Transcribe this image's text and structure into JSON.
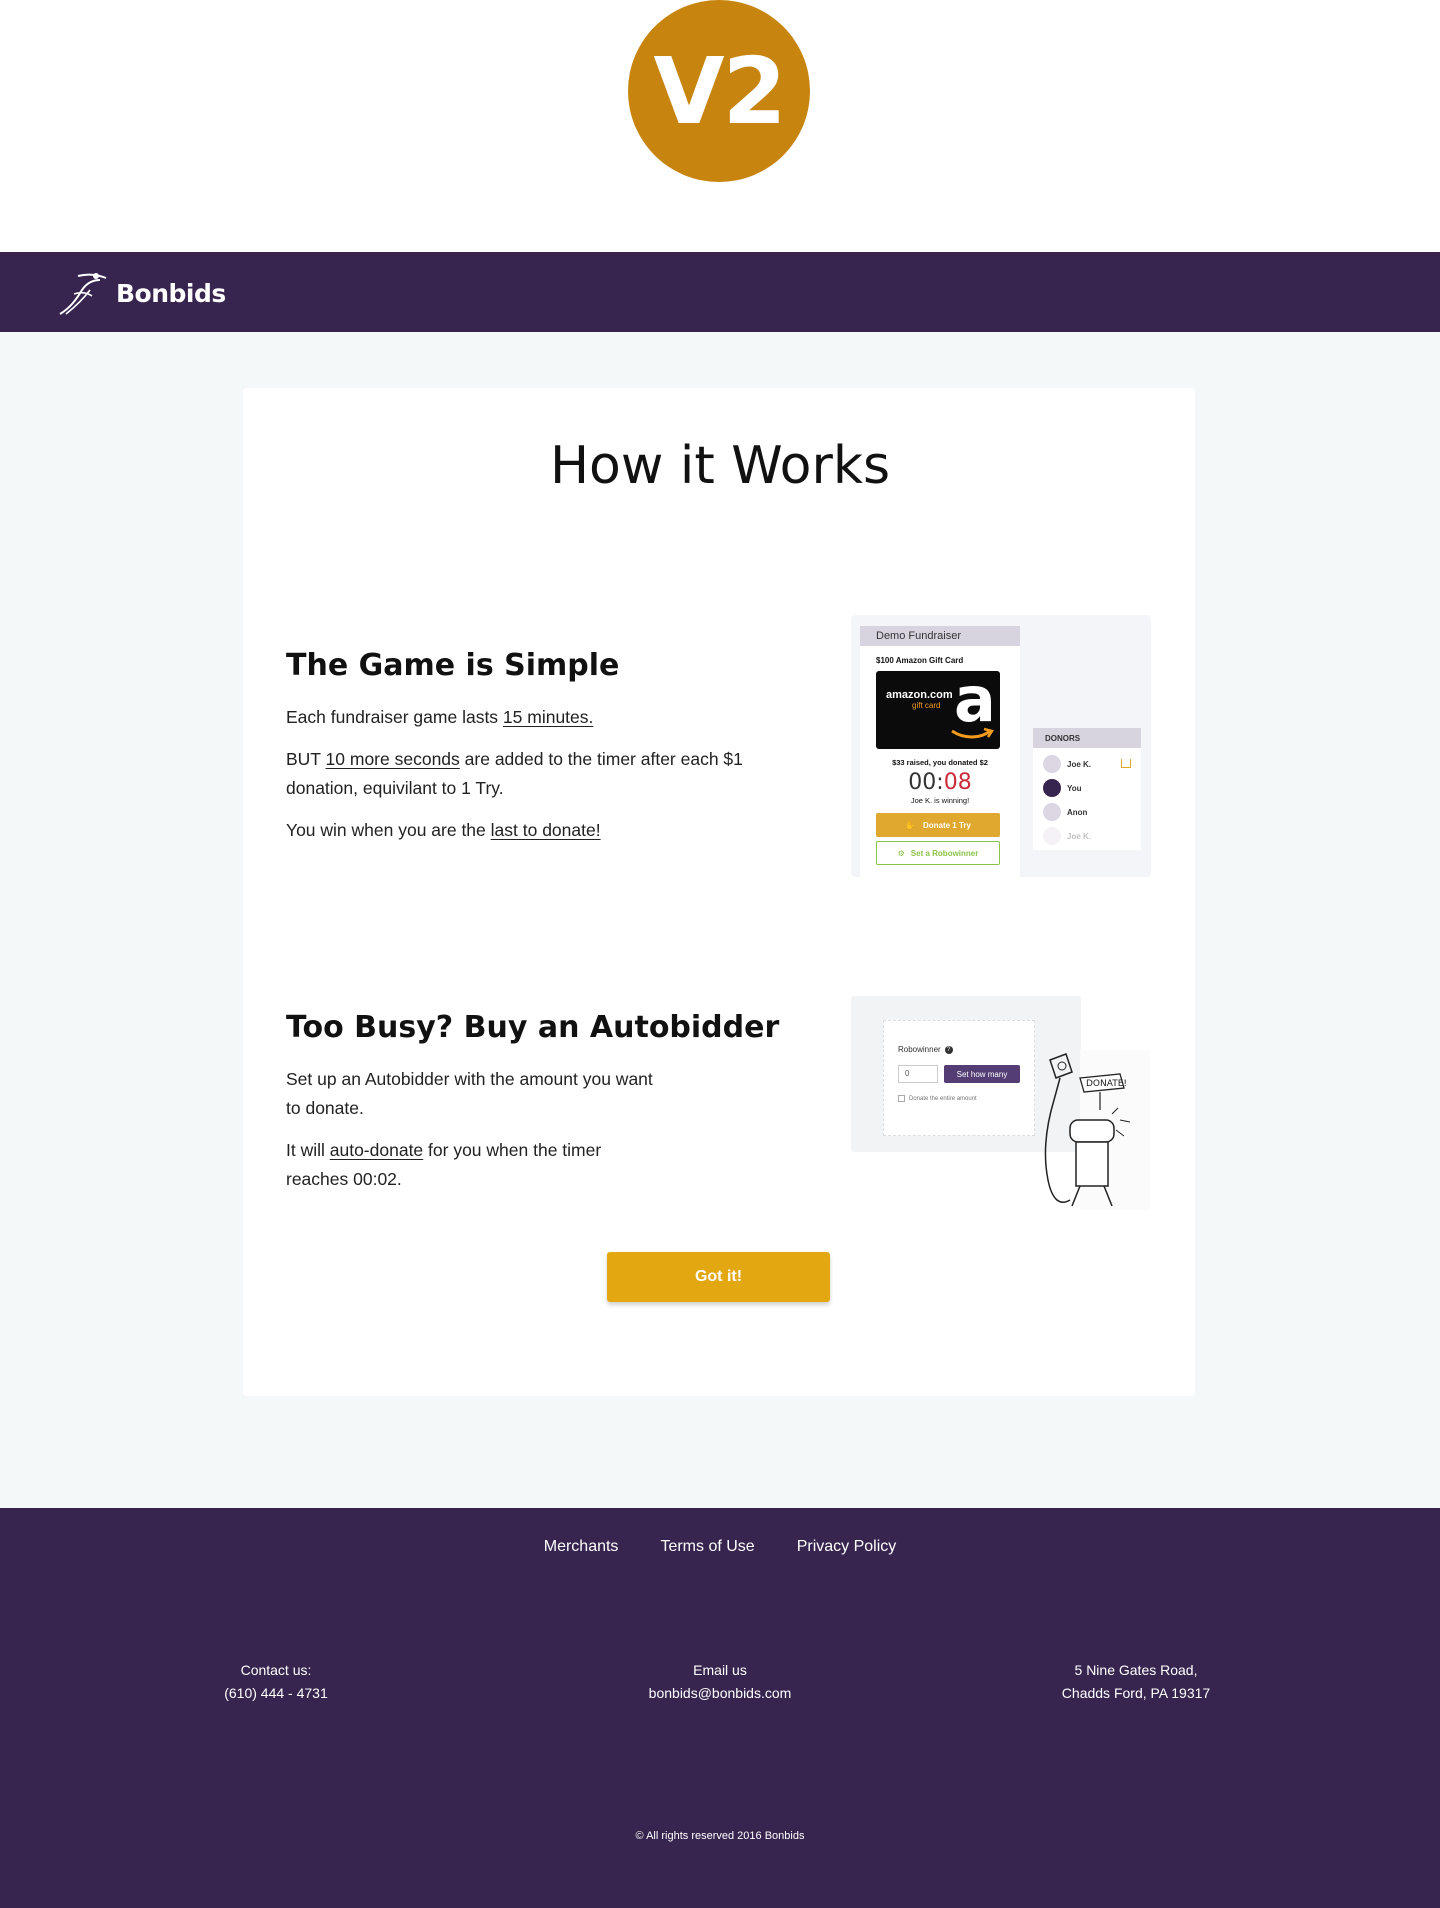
{
  "badge": {
    "label": "V2"
  },
  "header": {
    "brand": "Bonbids"
  },
  "main": {
    "title": "How it Works",
    "section1": {
      "title": "The Game is Simple",
      "p1_pre": "Each fundraiser game lasts ",
      "p1_link": "15 minutes. ",
      "p2_pre": "BUT ",
      "p2_link": "10 more seconds",
      "p2_post": " are added to the timer after each $1",
      "p2_line2": "donation, equivilant to 1 Try.",
      "p3_pre": "You win when you are the ",
      "p3_link": "last to donate!"
    },
    "section2": {
      "title": "Too Busy? Buy an Autobidder",
      "p1_line1": "Set up an Autobidder with the amount you want",
      "p1_line2": "to donate.",
      "p2_pre": "It will ",
      "p2_link": "auto-donate",
      "p2_post": " for you when the timer",
      "p2_line2": "reaches 00:02."
    },
    "cta": "Got it!"
  },
  "demo": {
    "header": "Demo Fundraiser",
    "prize": "$100 Amazon Gift Card",
    "gift_text": "amazon.com",
    "gift_sub": "gift card",
    "gift_letter": "a",
    "raised": "$33 raised, you donated $2",
    "timer_min": "00:",
    "timer_sec": "08",
    "winning": "Joe K. is winning!",
    "donate_btn": "Donate 1 Try",
    "robo_btn": "Set a Robowinner",
    "donors_title": "DONORS",
    "donors": [
      "Joe K.",
      "You",
      "Anon",
      "Joe K."
    ]
  },
  "robo": {
    "label": "Robowinner",
    "qmark": "?",
    "input_value": "0",
    "button": "Set how many",
    "check": "Donate the entire amount",
    "sign": "DONATE!"
  },
  "footer": {
    "links": [
      "Merchants",
      "Terms of Use",
      "Privacy Policy"
    ],
    "contact_label": "Contact us:",
    "contact_phone": "(610) 444 - 4731",
    "email_label": "Email us",
    "email": "bonbids@bonbids.com",
    "address_1": "5 Nine Gates Road,",
    "address_2": "Chadds Ford, PA 19317",
    "copyright": "© All rights reserved 2016 Bonbids"
  },
  "colors": {
    "brand_purple": "#38254f",
    "accent_gold": "#e2a711",
    "badge": "#c7850f"
  }
}
